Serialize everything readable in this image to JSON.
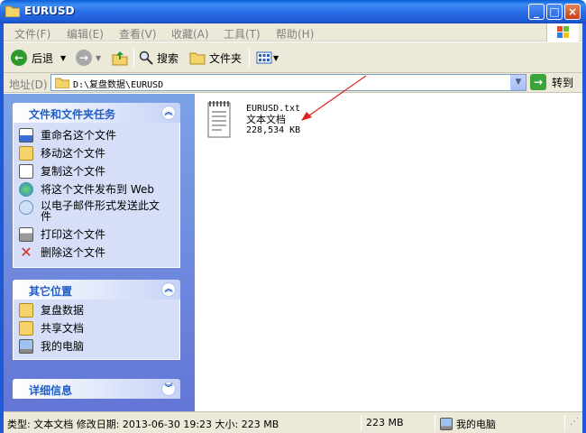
{
  "window": {
    "title": "EURUSD"
  },
  "menu": [
    "文件(F)",
    "编辑(E)",
    "查看(V)",
    "收藏(A)",
    "工具(T)",
    "帮助(H)"
  ],
  "toolbar": {
    "back": "后退",
    "search": "搜索",
    "folders": "文件夹"
  },
  "address": {
    "label": "地址(D)",
    "path": "D:\\复盘数据\\EURUSD",
    "goto": "转到"
  },
  "file_tasks": {
    "header": "文件和文件夹任务",
    "items": [
      "重命名这个文件",
      "移动这个文件",
      "复制这个文件",
      "将这个文件发布到 Web",
      "以电子邮件形式发送此文件",
      "打印这个文件",
      "删除这个文件"
    ]
  },
  "other_places": {
    "header": "其它位置",
    "items": [
      "复盘数据",
      "共享文档",
      "我的电脑"
    ]
  },
  "details": {
    "header": "详细信息"
  },
  "file": {
    "name": "EURUSD.txt",
    "type": "文本文档",
    "size": "228,534 KB"
  },
  "status": {
    "info": "类型: 文本文档 修改日期: 2013-06-30 19:23 大小: 223 MB",
    "size": "223 MB",
    "location": "我的电脑"
  }
}
